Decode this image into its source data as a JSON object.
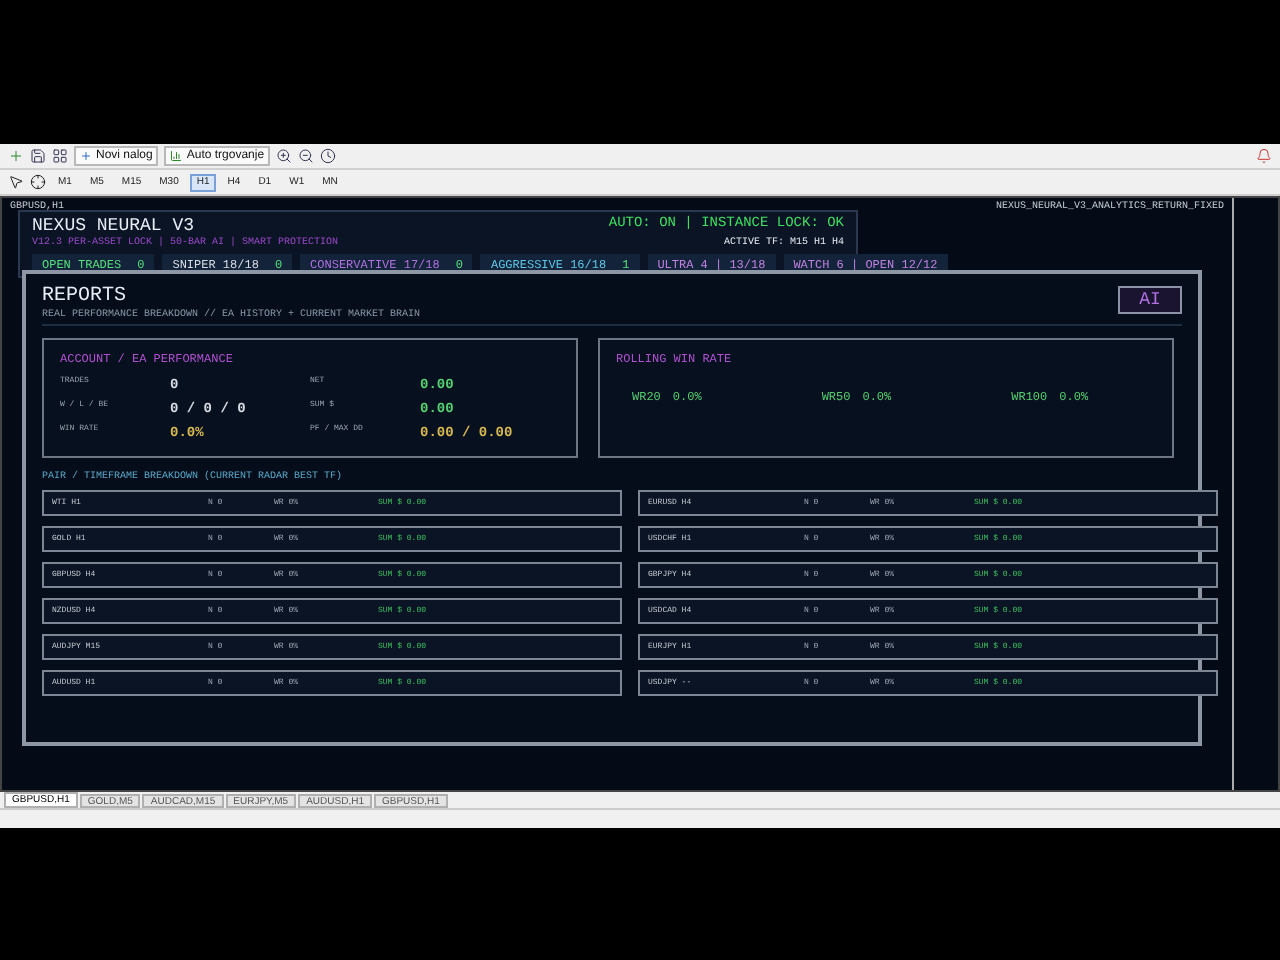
{
  "toolbar": {
    "buttons": [
      {
        "label": "Novi nalog",
        "kind": "order"
      },
      {
        "label": "Auto trgovanje",
        "kind": "auto"
      }
    ],
    "timeframes": [
      {
        "label": "M1",
        "selected": false
      },
      {
        "label": "M5",
        "selected": false
      },
      {
        "label": "M15",
        "selected": false
      },
      {
        "label": "M30",
        "selected": false
      },
      {
        "label": "H1",
        "selected": true
      },
      {
        "label": "H4",
        "selected": false
      },
      {
        "label": "D1",
        "selected": false
      },
      {
        "label": "W1",
        "selected": false
      },
      {
        "label": "MN",
        "selected": false
      }
    ]
  },
  "chart": {
    "symbol_line": "GBPUSD,H1",
    "indicator": "NEXUS_NEURAL_V3_ANALYTICS_RETURN_FIXED"
  },
  "ea_header": {
    "title": "NEXUS NEURAL V3",
    "subtitle": "V12.3 PER-ASSET LOCK | 50-BAR AI | SMART PROTECTION",
    "status": "AUTO: ON | INSTANCE LOCK: OK",
    "active_tf": "ACTIVE TF: M15 H1 H4",
    "chips": [
      {
        "label": "OPEN TRADES",
        "count": "0",
        "color": "#55e07a"
      },
      {
        "label": "SNIPER 18/18",
        "count": "0",
        "color": "#d8dce4"
      },
      {
        "label": "CONSERVATIVE 17/18",
        "count": "0",
        "color": "#b070e0"
      },
      {
        "label": "AGGRESSIVE 16/18",
        "count": "1",
        "color": "#5ec8e8"
      },
      {
        "label": "ULTRA 4 | 13/18",
        "color": "#c080e0"
      },
      {
        "label": "WATCH 6 | OPEN 12/12",
        "color": "#c080e0"
      }
    ]
  },
  "reports": {
    "title": "REPORTS",
    "subtitle": "REAL PERFORMANCE BREAKDOWN // EA HISTORY + CURRENT MARKET BRAIN",
    "ai_button": "AI",
    "account": {
      "title": "ACCOUNT / EA PERFORMANCE",
      "fields": [
        {
          "label": "TRADES",
          "value": "0",
          "color": "#d8dce4"
        },
        {
          "label": "NET",
          "value": "0.00",
          "color": "#55d070"
        },
        {
          "label": "W / L / BE",
          "value": "0 / 0 / 0",
          "color": "#d8dce4"
        },
        {
          "label": "SUM $",
          "value": "0.00",
          "color": "#55d070"
        },
        {
          "label": "WIN RATE",
          "value": "0.0%",
          "color": "#d8b850"
        },
        {
          "label": "PF / MAX DD",
          "value": "0.00 / 0.00",
          "color": "#d8b850"
        }
      ]
    },
    "rolling": {
      "title": "ROLLING WIN RATE",
      "items": [
        {
          "label": "WR20",
          "value": "0.0%"
        },
        {
          "label": "WR50",
          "value": "0.0%"
        },
        {
          "label": "WR100",
          "value": "0.0%"
        }
      ]
    },
    "breakdown": {
      "title": "PAIR / TIMEFRAME BREAKDOWN (CURRENT RADAR BEST TF)",
      "rows": [
        {
          "pair": "WTI H1",
          "n": "N 0",
          "wr": "WR 0%",
          "sum": "SUM $ 0.00"
        },
        {
          "pair": "EURUSD H4",
          "n": "N 0",
          "wr": "WR 0%",
          "sum": "SUM $ 0.00"
        },
        {
          "pair": "GOLD H1",
          "n": "N 0",
          "wr": "WR 0%",
          "sum": "SUM $ 0.00"
        },
        {
          "pair": "USDCHF H1",
          "n": "N 0",
          "wr": "WR 0%",
          "sum": "SUM $ 0.00"
        },
        {
          "pair": "GBPUSD H4",
          "n": "N 0",
          "wr": "WR 0%",
          "sum": "SUM $ 0.00"
        },
        {
          "pair": "GBPJPY H4",
          "n": "N 0",
          "wr": "WR 0%",
          "sum": "SUM $ 0.00"
        },
        {
          "pair": "NZDUSD H4",
          "n": "N 0",
          "wr": "WR 0%",
          "sum": "SUM $ 0.00"
        },
        {
          "pair": "USDCAD H4",
          "n": "N 0",
          "wr": "WR 0%",
          "sum": "SUM $ 0.00"
        },
        {
          "pair": "AUDJPY M15",
          "n": "N 0",
          "wr": "WR 0%",
          "sum": "SUM $ 0.00"
        },
        {
          "pair": "EURJPY H1",
          "n": "N 0",
          "wr": "WR 0%",
          "sum": "SUM $ 0.00"
        },
        {
          "pair": "AUDUSD H1",
          "n": "N 0",
          "wr": "WR 0%",
          "sum": "SUM $ 0.00"
        },
        {
          "pair": "USDJPY --",
          "n": "N 0",
          "wr": "WR 0%",
          "sum": "SUM $ 0.00"
        }
      ]
    }
  },
  "chart_tabs": [
    {
      "label": "GBPUSD,H1",
      "selected": true
    },
    {
      "label": "GOLD,M5",
      "selected": false
    },
    {
      "label": "AUDCAD,M15",
      "selected": false
    },
    {
      "label": "EURJPY,M5",
      "selected": false
    },
    {
      "label": "AUDUSD,H1",
      "selected": false
    },
    {
      "label": "GBPUSD,H1",
      "selected": false
    }
  ]
}
